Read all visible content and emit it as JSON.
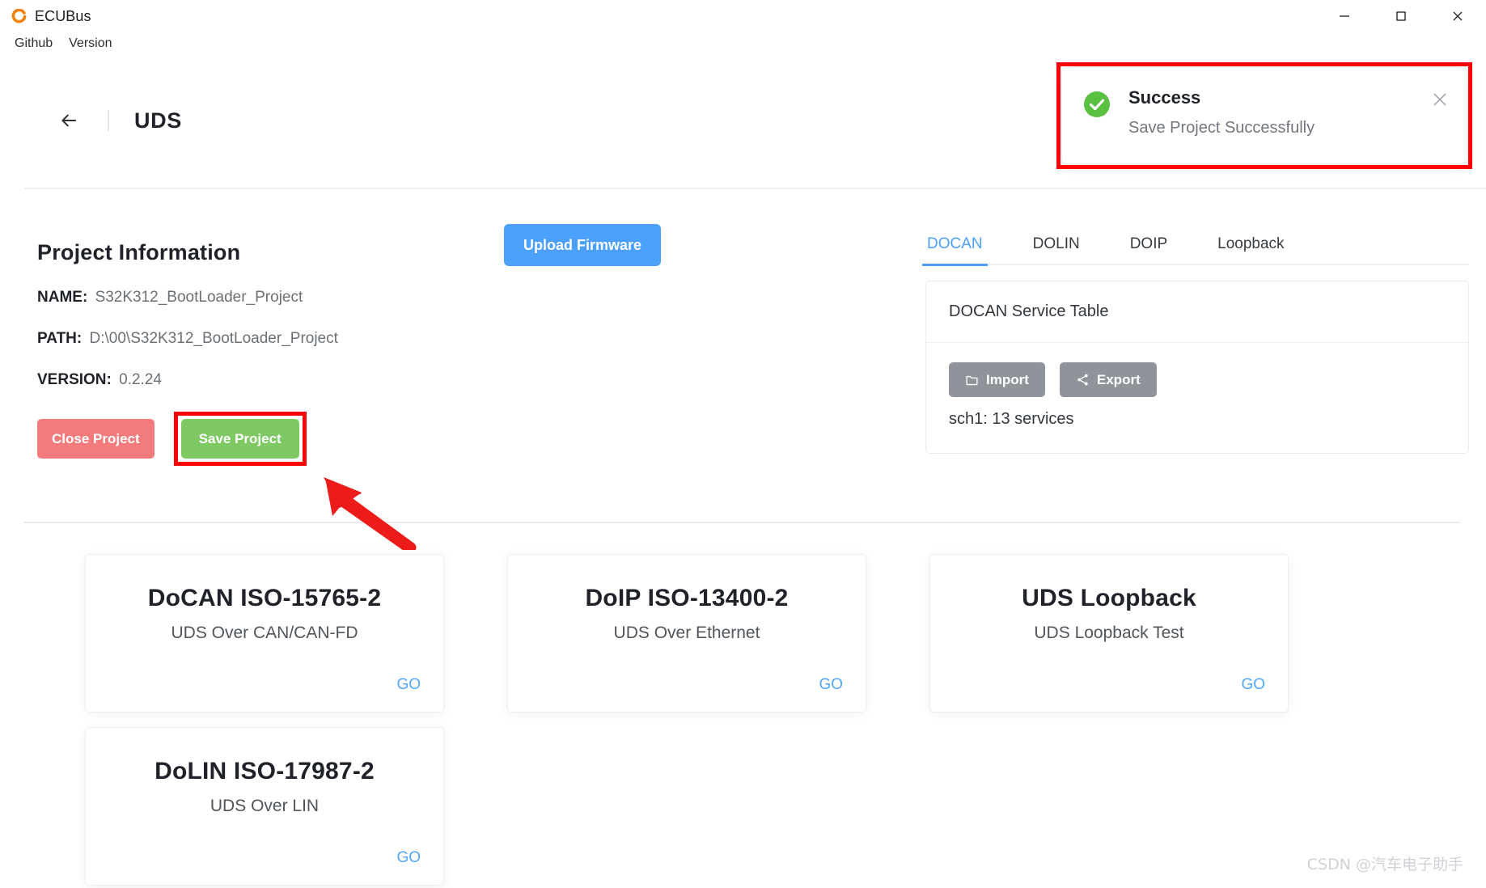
{
  "window": {
    "app_title": "ECUBus",
    "logo": "ecubus-logo-icon",
    "controls": {
      "minimize": "minimize-icon",
      "maximize": "maximize-icon",
      "close": "close-icon"
    }
  },
  "menubar": {
    "items": [
      {
        "label": "Github"
      },
      {
        "label": "Version"
      }
    ]
  },
  "header": {
    "back": "back-arrow-icon",
    "title": "UDS"
  },
  "project_information": {
    "heading": "Project Information",
    "fields": [
      {
        "key": "NAME:",
        "value": "S32K312_BootLoader_Project"
      },
      {
        "key": "PATH:",
        "value": "D:\\00\\S32K312_BootLoader_Project"
      },
      {
        "key": "VERSION:",
        "value": "0.2.24"
      }
    ],
    "close_button": "Close Project",
    "save_button": "Save Project"
  },
  "upload": {
    "label": "Upload Firmware"
  },
  "right_panel": {
    "tabs": [
      {
        "label": "DOCAN",
        "active": true
      },
      {
        "label": "DOLIN",
        "active": false
      },
      {
        "label": "DOIP",
        "active": false
      },
      {
        "label": "Loopback",
        "active": false
      }
    ],
    "service_card": {
      "title": "DOCAN Service Table",
      "import_label": "Import",
      "export_label": "Export",
      "count_text": "sch1: 13 services"
    }
  },
  "protocol_cards": [
    {
      "title": "DoCAN ISO-15765-2",
      "subtitle": "UDS Over CAN/CAN-FD",
      "go": "GO"
    },
    {
      "title": "DoIP ISO-13400-2",
      "subtitle": "UDS Over Ethernet",
      "go": "GO"
    },
    {
      "title": "UDS Loopback",
      "subtitle": "UDS Loopback Test",
      "go": "GO"
    },
    {
      "title": "DoLIN ISO-17987-2",
      "subtitle": "UDS Over LIN",
      "go": "GO"
    }
  ],
  "toast": {
    "icon": "success-check-icon",
    "title": "Success",
    "message": "Save Project Successfully",
    "close": "close-icon"
  },
  "watermark": "CSDN @汽车电子助手",
  "colors": {
    "accent_blue": "#4ba0fb",
    "success_green": "#7ec963",
    "danger_red": "#f47b7b",
    "annotation_red": "#fb0007",
    "info_gray": "#8f949b",
    "logo_orange": "#f0830a"
  }
}
